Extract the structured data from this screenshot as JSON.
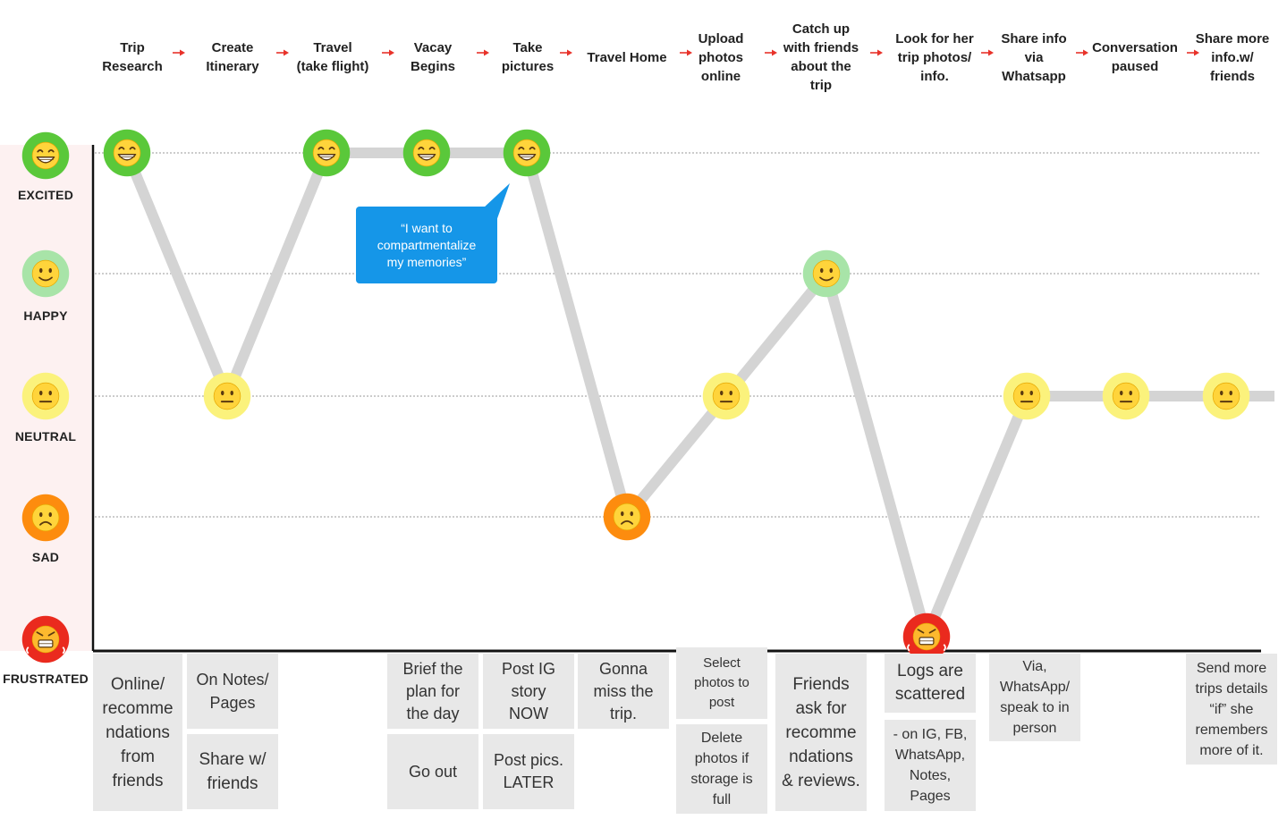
{
  "steps": [
    "Trip\nResearch",
    "Create\nItinerary",
    "Travel\n(take flight)",
    "Vacay\nBegins",
    "Take\npictures",
    "Travel Home",
    "Upload\nphotos\nonline",
    "Catch up\nwith friends\nabout the\ntrip",
    "Look for her\ntrip photos/\ninfo.",
    "Share info\nvia\nWhatsapp",
    "Conversation\npaused",
    "Share more\ninfo.w/\nfriends"
  ],
  "emotions": [
    "EXCITED",
    "HAPPY",
    "NEUTRAL",
    "SAD",
    "FRUSTRATED"
  ],
  "journey": [
    {
      "step": 1,
      "emotion": "EXCITED"
    },
    {
      "step": 2,
      "emotion": "NEUTRAL"
    },
    {
      "step": 3,
      "emotion": "EXCITED"
    },
    {
      "step": 4,
      "emotion": "EXCITED"
    },
    {
      "step": 5,
      "emotion": "EXCITED"
    },
    {
      "step": 6,
      "emotion": "SAD"
    },
    {
      "step": 7,
      "emotion": "NEUTRAL"
    },
    {
      "step": 8,
      "emotion": "HAPPY"
    },
    {
      "step": 9,
      "emotion": "FRUSTRATED"
    },
    {
      "step": 10,
      "emotion": "NEUTRAL"
    },
    {
      "step": 11,
      "emotion": "NEUTRAL"
    },
    {
      "step": 12,
      "emotion": "NEUTRAL"
    }
  ],
  "quote": "“I want to\ncompartmentalize\nmy memories”",
  "notes": {
    "online_recs": "Online/\nrecomme\nndations\nfrom\nfriends",
    "on_notes": "On Notes/\nPages",
    "share_w_friends": "Share w/\nfriends",
    "brief_plan": "Brief the\nplan for\nthe day",
    "go_out": "Go out",
    "post_ig": "Post IG\nstory\nNOW",
    "post_later": "Post pics.\nLATER",
    "miss_trip": "Gonna\nmiss the\ntrip.",
    "select_photos": "Select\nphotos to\npost",
    "delete_photos": "Delete\nphotos if\nstorage is\nfull",
    "friends_ask": "Friends\nask for\nrecomme\nndations\n& reviews.",
    "logs_scattered": "Logs are\nscattered",
    "on_ig": "- on IG, FB,\nWhatsApp,\nNotes,\nPages",
    "via_whatsapp": "Via,\nWhatsApp/\nspeak to in\nperson",
    "send_more": "Send more\ntrips details\n“if” she\nremembers\nmore of it."
  },
  "colors": {
    "excited": "#5ac83a",
    "happy": "#a8e4a8",
    "neutral": "#fbf27c",
    "sad": "#fd8c0e",
    "frustrated": "#ea2a1e",
    "line": "#d4d4d4",
    "quote_bg": "#1596e8",
    "arrow": "#e8322a"
  }
}
